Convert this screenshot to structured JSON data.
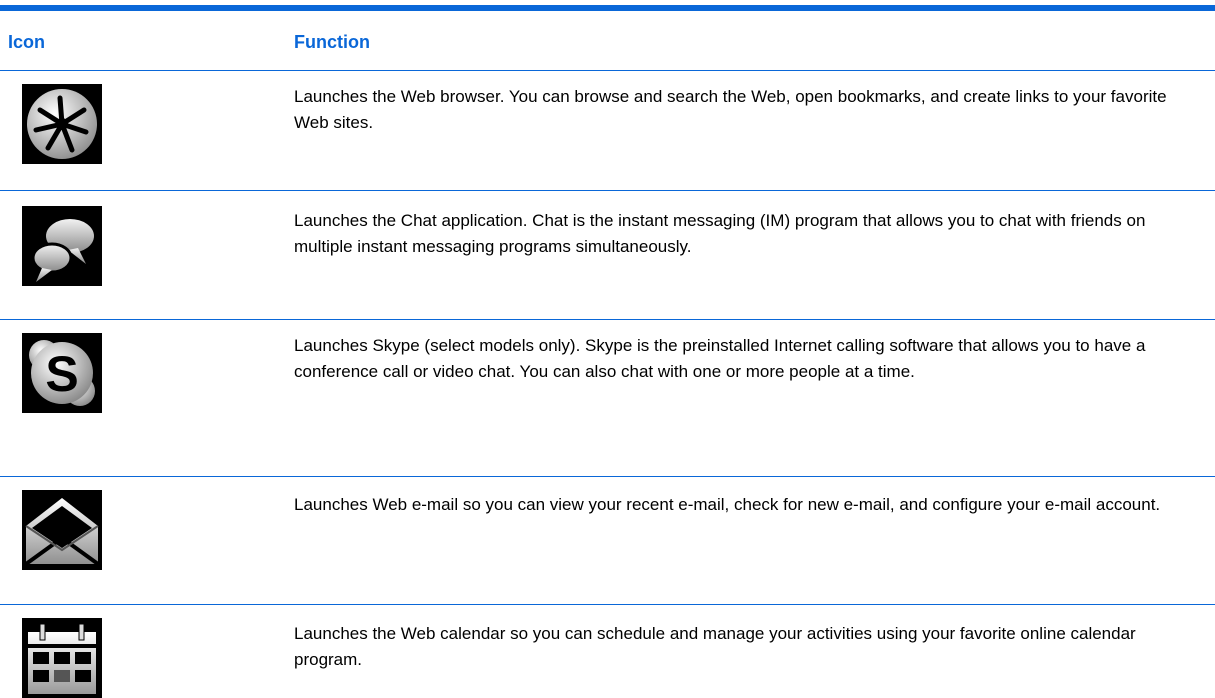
{
  "table": {
    "header": {
      "icon": "Icon",
      "function": "Function"
    },
    "rows": [
      {
        "icon": "web-browser-icon",
        "function": "Launches the Web browser. You can browse and search the Web, open bookmarks, and create links to your favorite Web sites."
      },
      {
        "icon": "chat-bubbles-icon",
        "function": "Launches the Chat application. Chat is the instant messaging (IM) program that allows you to chat with friends on multiple instant messaging programs simultaneously."
      },
      {
        "icon": "skype-icon",
        "function": "Launches Skype (select models only). Skype is the preinstalled Internet calling software that allows you to have a conference call or video chat. You can also chat with one or more people at a time."
      },
      {
        "icon": "envelope-icon",
        "function": "Launches Web e-mail so you can view your recent e-mail, check for new e-mail, and configure your e-mail account."
      },
      {
        "icon": "calendar-icon",
        "function": "Launches the Web calendar so you can schedule and manage your activities using your favorite online calendar program."
      }
    ]
  },
  "colors": {
    "accent": "#0a67d8"
  }
}
